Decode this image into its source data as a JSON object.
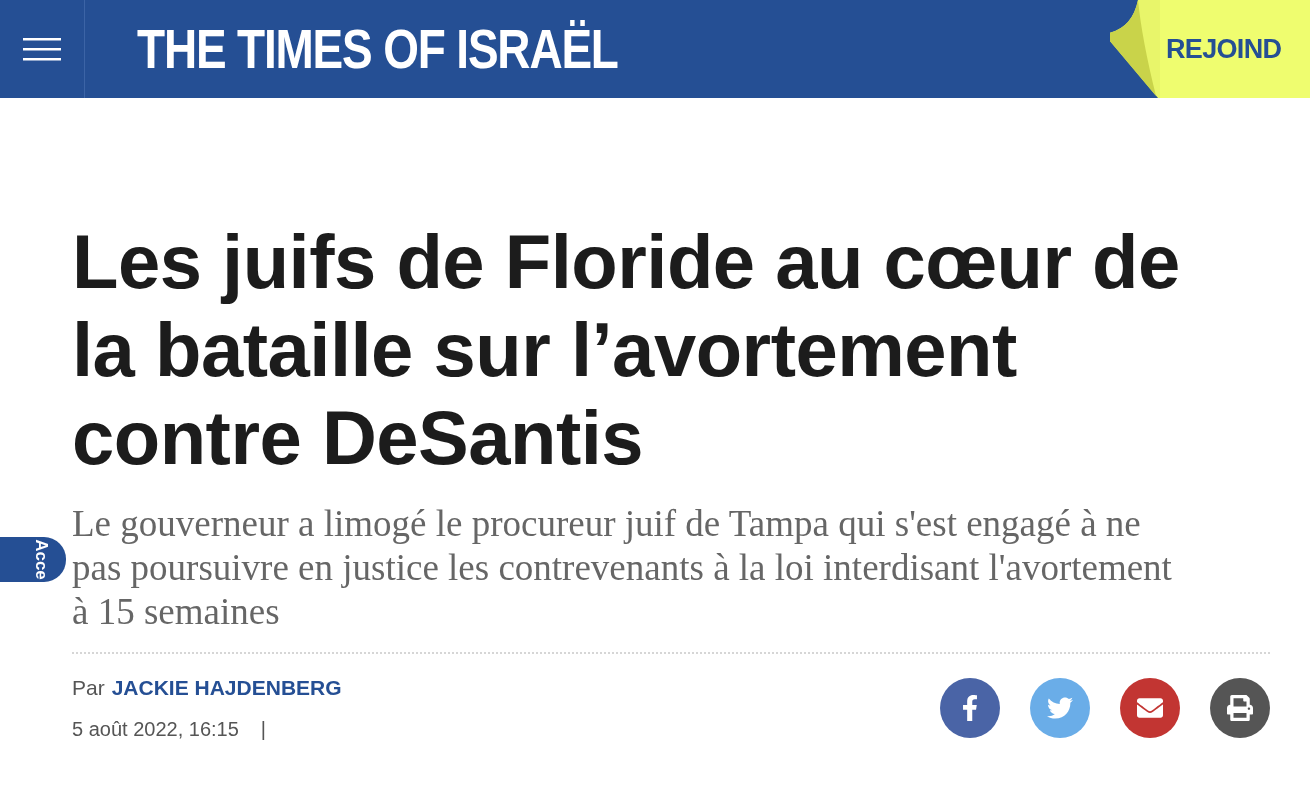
{
  "header": {
    "logo": "THE TIMES OF ISRAËL",
    "join_label": "REJOIND"
  },
  "side_tab": {
    "label": "Acce"
  },
  "article": {
    "headline": "Les juifs de Floride au cœur de la bataille sur l’avortement contre DeSantis",
    "deck": "Le gouverneur a limogé le procureur juif de Tampa qui s'est engagé à ne pas poursuivre en justice les contrevenants à la loi interdisant l'avortement à 15 semaines",
    "byline_prefix": "Par",
    "author": "JACKIE HAJDENBERG",
    "date": "5 août 2022, 16:15",
    "separator": "|"
  },
  "share_buttons": [
    {
      "kind": "facebook"
    },
    {
      "kind": "twitter"
    },
    {
      "kind": "email"
    },
    {
      "kind": "print"
    }
  ]
}
